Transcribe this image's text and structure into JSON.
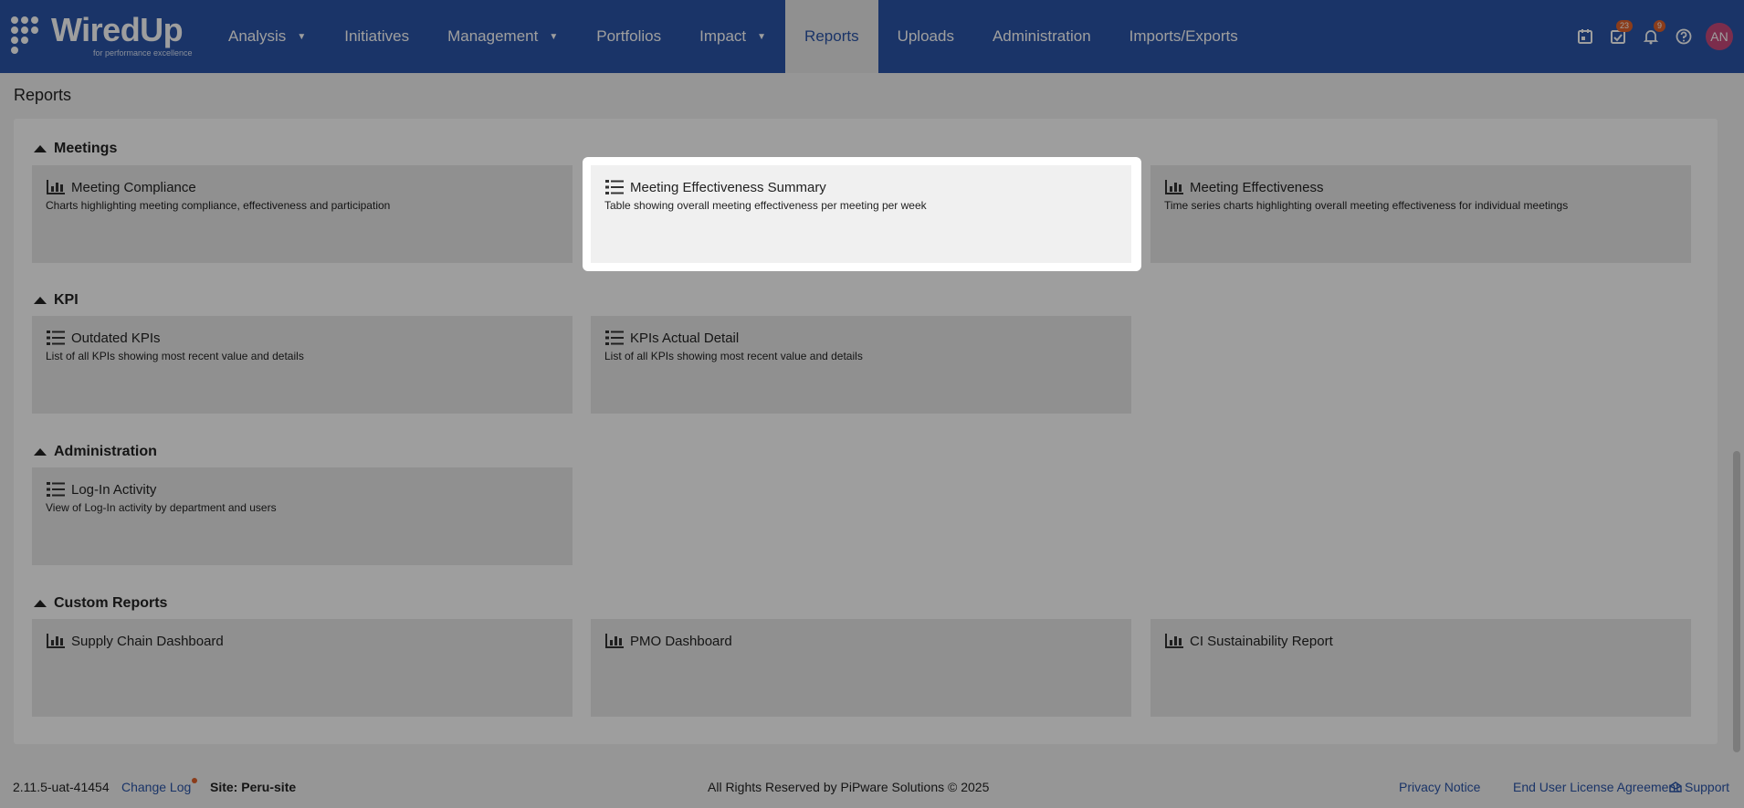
{
  "brand": {
    "name": "WiredUp",
    "tagline": "for performance excellence"
  },
  "nav": [
    {
      "label": "Analysis",
      "caret": true
    },
    {
      "label": "Initiatives",
      "caret": false
    },
    {
      "label": "Management",
      "caret": true
    },
    {
      "label": "Portfolios",
      "caret": false
    },
    {
      "label": "Impact",
      "caret": true
    },
    {
      "label": "Reports",
      "caret": false,
      "active": true
    },
    {
      "label": "Uploads",
      "caret": false
    },
    {
      "label": "Administration",
      "caret": false
    },
    {
      "label": "Imports/Exports",
      "caret": false
    }
  ],
  "toolbar": {
    "calendar_icon": "calendar-icon",
    "tasks_badge": "23",
    "notifications_badge": "9",
    "help_icon": "help-icon",
    "avatar_initials": "AN"
  },
  "page": {
    "title": "Reports"
  },
  "sections": {
    "meetings": {
      "title": "Meetings",
      "cards": [
        {
          "icon": "bar-chart-icon",
          "title": "Meeting Compliance",
          "desc": "Charts highlighting meeting compliance, effectiveness and participation"
        },
        {
          "icon": "list-icon",
          "title": "Meeting Effectiveness Summary",
          "desc": "Table showing overall meeting effectiveness per meeting per week"
        },
        {
          "icon": "bar-chart-icon",
          "title": "Meeting Effectiveness",
          "desc": "Time series charts highlighting overall meeting effectiveness for individual meetings"
        }
      ]
    },
    "kpi": {
      "title": "KPI",
      "cards": [
        {
          "icon": "list-icon",
          "title": "Outdated KPIs",
          "desc": "List of all KPIs showing most recent value and details"
        },
        {
          "icon": "list-icon",
          "title": "KPIs Actual Detail",
          "desc": "List of all KPIs showing most recent value and details"
        }
      ]
    },
    "administration": {
      "title": "Administration",
      "cards": [
        {
          "icon": "list-icon",
          "title": "Log-In Activity",
          "desc": "View of Log-In activity by department and users"
        }
      ]
    },
    "custom": {
      "title": "Custom Reports",
      "cards": [
        {
          "icon": "bar-chart-icon",
          "title": "Supply Chain Dashboard",
          "desc": ""
        },
        {
          "icon": "bar-chart-icon",
          "title": "PMO Dashboard",
          "desc": ""
        },
        {
          "icon": "bar-chart-icon",
          "title": "CI Sustainability Report",
          "desc": ""
        }
      ]
    }
  },
  "footer": {
    "version": "2.11.5-uat-41454",
    "changelog": "Change Log",
    "site_label": "Site: Peru-site",
    "copyright": "All Rights Reserved by PiPware Solutions © 2025",
    "privacy": "Privacy Notice",
    "eula": "End User License Agreement",
    "support": "Support"
  },
  "colors": {
    "nav_bg": "#2b55a8",
    "badge": "#e0622a",
    "avatar": "#c94a7b",
    "link": "#2b55a8"
  }
}
